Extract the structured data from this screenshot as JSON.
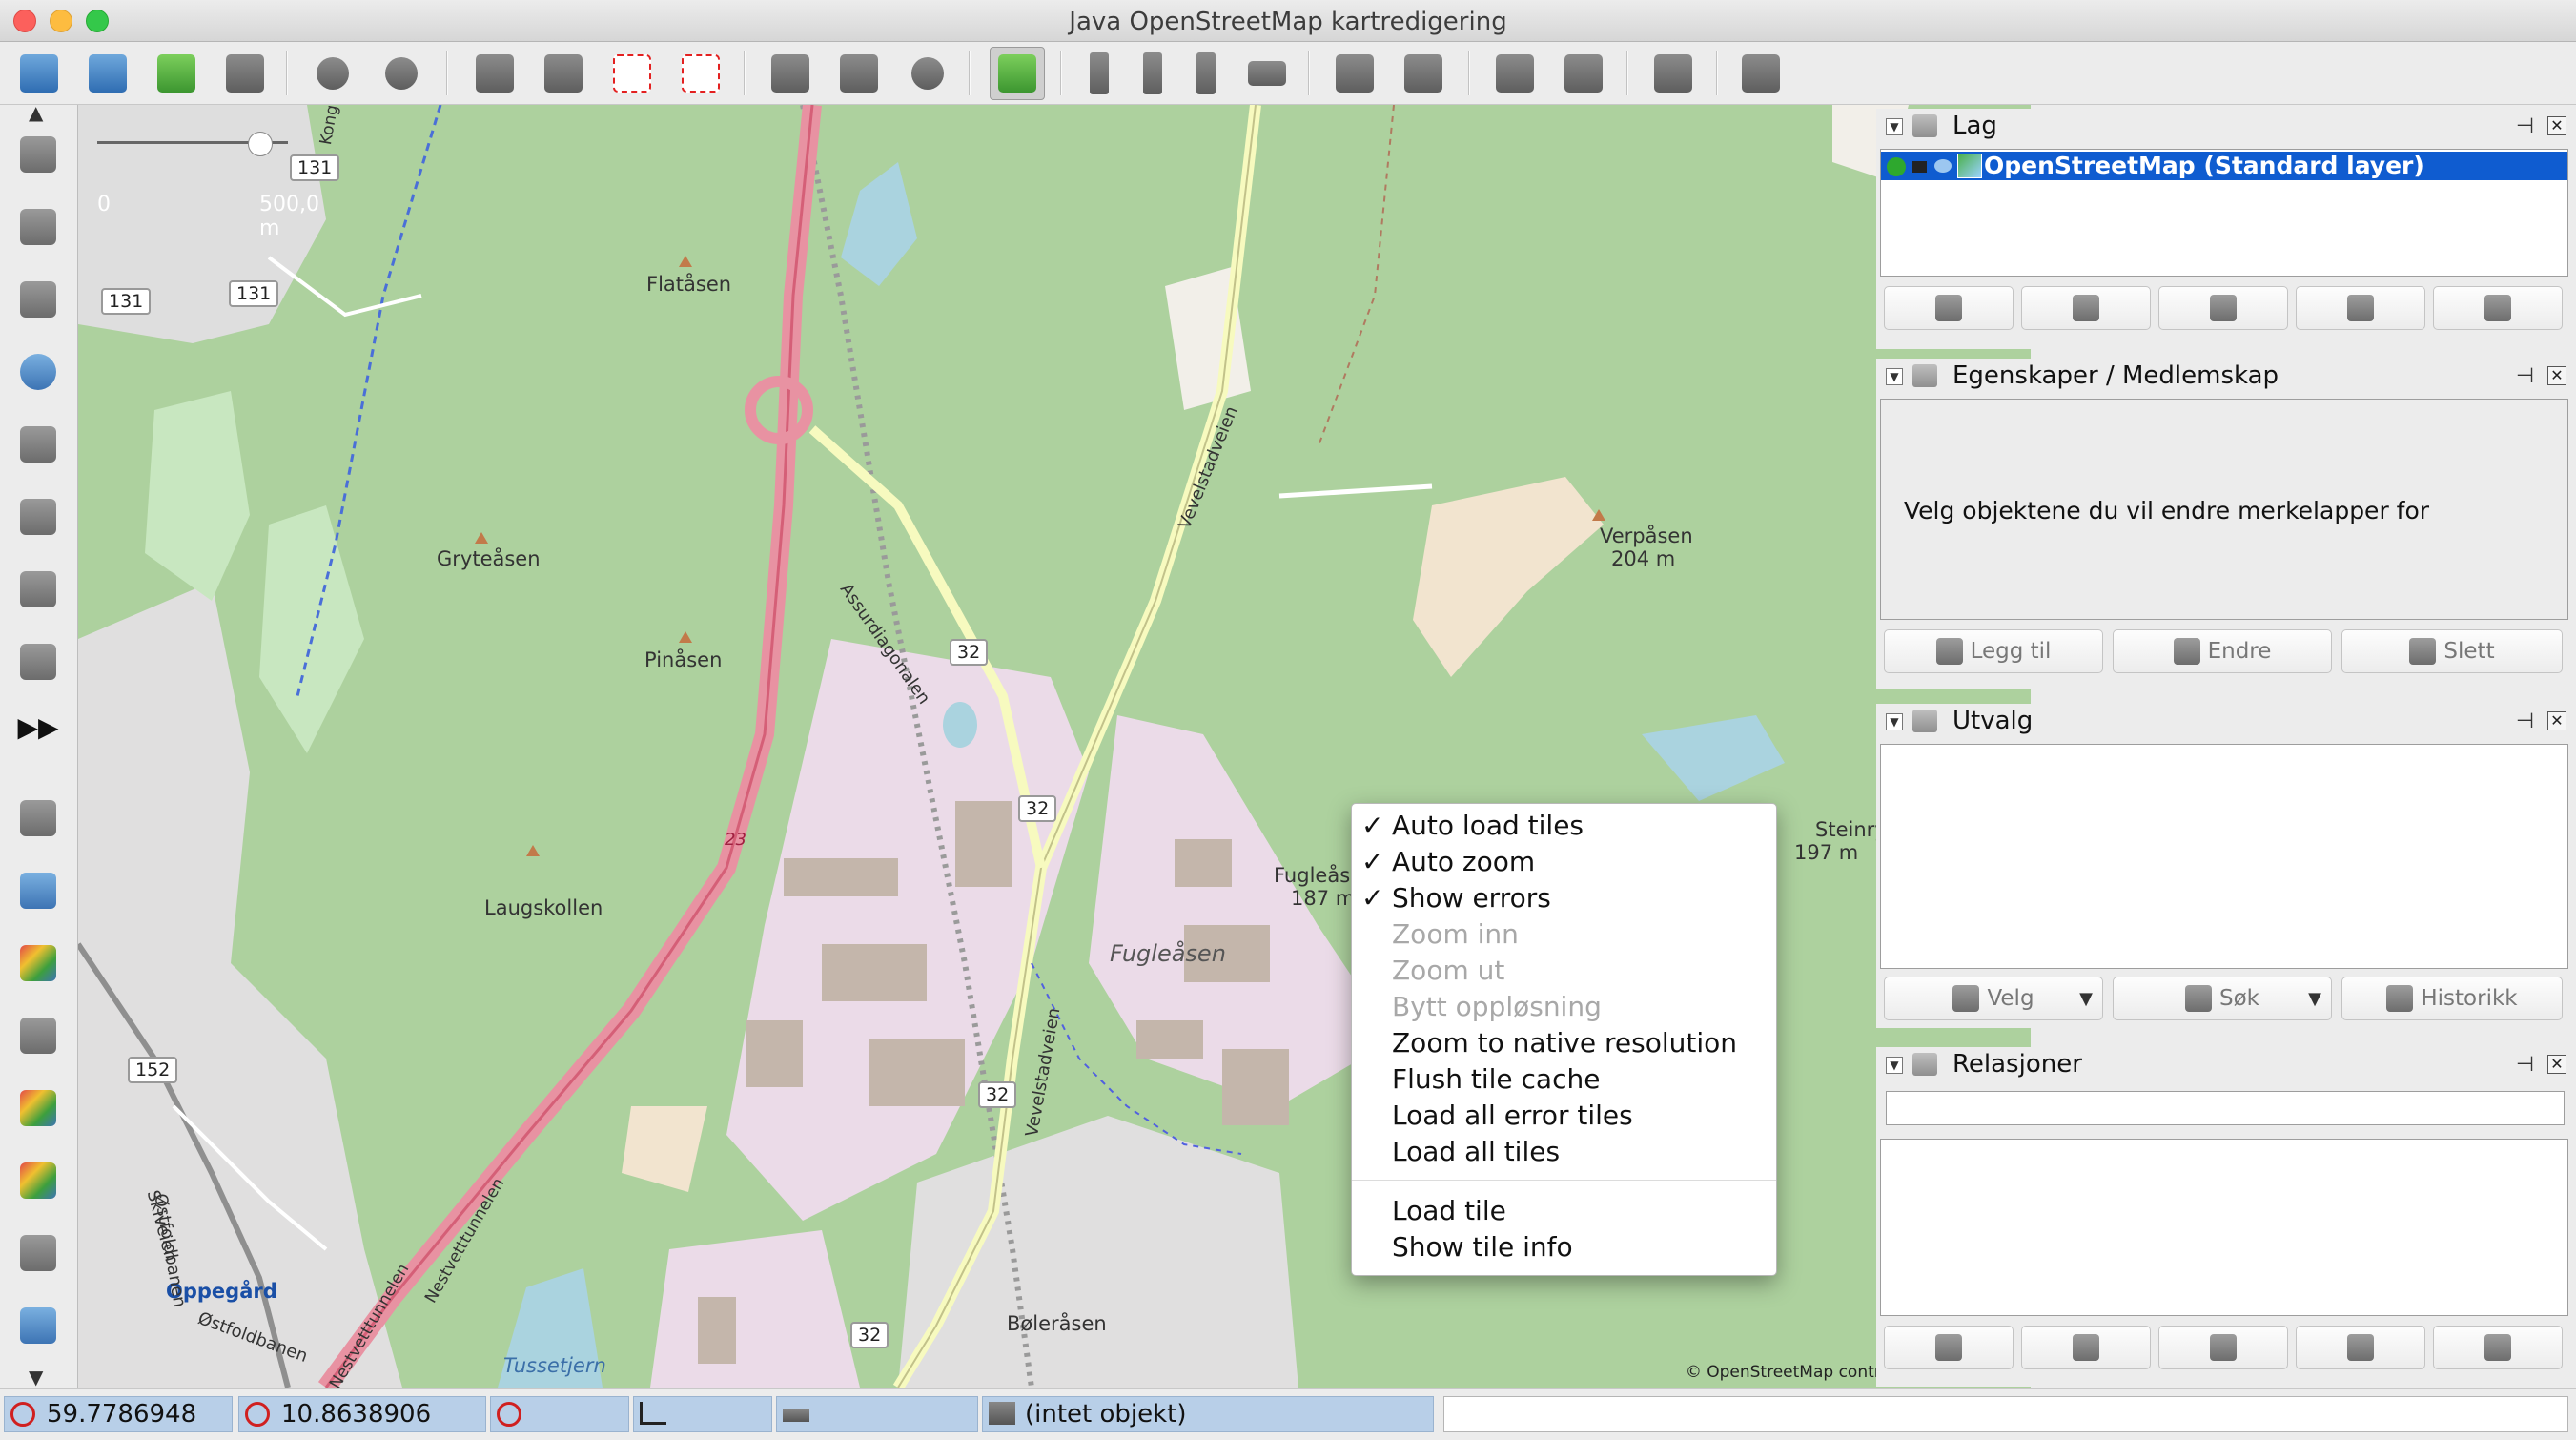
{
  "window": {
    "title": "Java OpenStreetMap kartredigering"
  },
  "toolbar": {
    "buttons": [
      "open-file-icon",
      "save-icon",
      "download-icon",
      "upload-icon",
      "undo-icon",
      "redo-icon",
      "preferences-icon",
      "info-icon",
      "zoom-data-icon",
      "zoom-selection-icon",
      "split-way-icon",
      "combine-way-icon",
      "reverse-icon",
      "satellite-icon",
      "building-icon",
      "shop-icon",
      "road-icon",
      "car-icon",
      "bus-icon",
      "parking-icon",
      "restaurant-icon",
      "castle-icon",
      "industry-icon"
    ]
  },
  "lefttoolbar": {
    "tools": [
      "select-icon",
      "lasso-icon",
      "draw-icon",
      "zoom-icon",
      "delete-icon",
      "parallel-icon",
      "improve-way-icon",
      "extrude-icon",
      "more-icon",
      "layers-toggle-icon",
      "tags-toggle-icon",
      "selection-toggle-icon",
      "relations-toggle-icon",
      "history-toggle-icon",
      "commands-toggle-icon",
      "filter-toggle-icon",
      "conflict-toggle-icon"
    ]
  },
  "map": {
    "scale": {
      "left_text": "0",
      "right_text": "500,0 m"
    },
    "labels": {
      "flatasen": "Flatåsen",
      "gryteasen": "Gryteåsen",
      "pinasen": "Pinåsen",
      "laugskollen": "Laugskollen",
      "fugleasen_italic": "Fugleåsen",
      "fugleasen": "Fugleåsen",
      "fugleasen_elev": "187 m",
      "verpasen": "Verpåsen",
      "verpasen_elev": "204 m",
      "steinrygget": "Steinrygget",
      "steinrygget_elev": "197 m",
      "oppegard": "Oppegård",
      "bolerasen": "Bøleråsen",
      "tussetjern": "Tussetjern",
      "assurdiagonalen": "Assurdiagonalen",
      "vevelstadveien1": "Vevelstadveien",
      "vevelstadveien2": "Vevelstadveien",
      "nestvetttunnelen1": "Nestvetttunnelen",
      "nestvetttunnelen2": "Nestvetttunnelen",
      "ostfoldbanen1": "Østfoldbanen",
      "ostfoldbanen2": "Østfoldbanen",
      "skiveien": "Skiveien",
      "kong": "Kong",
      "road23": "23"
    },
    "shields": {
      "s131a": "131",
      "s131b": "131",
      "s131c": "131",
      "s152": "152",
      "s32a": "32",
      "s32b": "32",
      "s32c": "32",
      "s32d": "32"
    },
    "attribution": "© OpenStreetMap contributors, CC-BY-SA"
  },
  "context_menu": {
    "items": [
      {
        "label": "Auto load tiles",
        "checked": true,
        "enabled": true
      },
      {
        "label": "Auto zoom",
        "checked": true,
        "enabled": true
      },
      {
        "label": "Show errors",
        "checked": true,
        "enabled": true
      },
      {
        "label": "Zoom inn",
        "checked": false,
        "enabled": false
      },
      {
        "label": "Zoom ut",
        "checked": false,
        "enabled": false
      },
      {
        "label": "Bytt oppløsning",
        "checked": false,
        "enabled": false
      },
      {
        "label": "Zoom to native resolution",
        "checked": false,
        "enabled": true
      },
      {
        "label": "Flush tile cache",
        "checked": false,
        "enabled": true
      },
      {
        "label": "Load all error tiles",
        "checked": false,
        "enabled": true
      },
      {
        "label": "Load all tiles",
        "checked": false,
        "enabled": true
      },
      {
        "label": "Load tile",
        "checked": false,
        "enabled": true
      },
      {
        "label": "Show tile info",
        "checked": false,
        "enabled": true
      }
    ],
    "check_glyph": "✓"
  },
  "panels": {
    "layers": {
      "title": "Lag",
      "layer_name": "OpenStreetMap (Standard layer)"
    },
    "properties": {
      "title": "Egenskaper / Medlemskap",
      "empty_text": "Velg objektene du vil endre merkelapper for",
      "add": "Legg til",
      "edit": "Endre",
      "delete": "Slett"
    },
    "selection": {
      "title": "Utvalg",
      "select": "Velg",
      "search": "Søk",
      "history": "Historikk"
    },
    "relations": {
      "title": "Relasjoner"
    }
  },
  "statusbar": {
    "lat": "59.7786948",
    "lon": "10.8638906",
    "object": "(intet objekt)"
  }
}
